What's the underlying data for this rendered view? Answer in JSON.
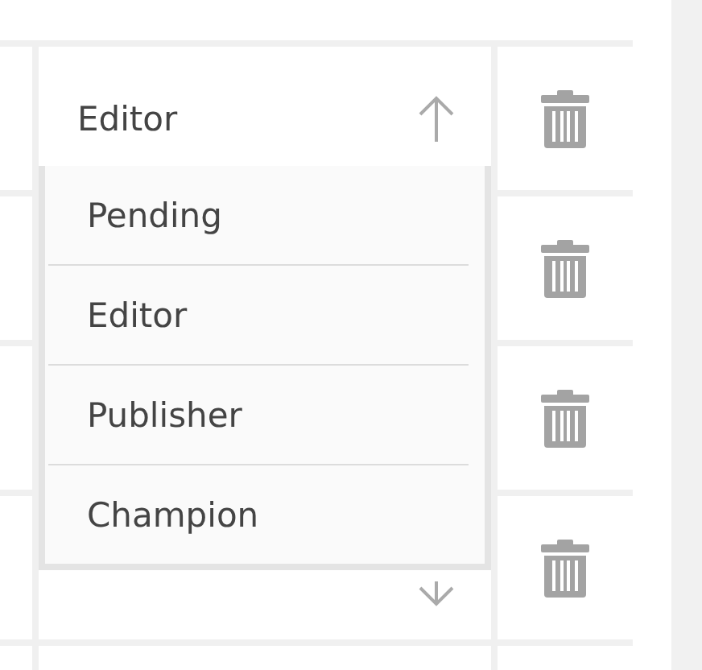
{
  "rows": [
    {
      "role": "Editor",
      "expanded": true,
      "options": [
        "Pending",
        "Editor",
        "Publisher",
        "Champion"
      ]
    },
    {},
    {},
    {
      "expanded": false
    }
  ]
}
